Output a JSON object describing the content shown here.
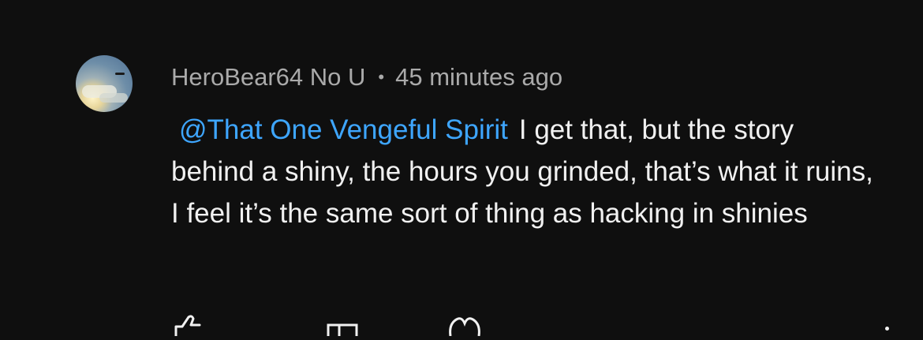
{
  "comment": {
    "author": "HeroBear64 No U",
    "separator": "•",
    "timestamp": "45 minutes ago",
    "mention": "@That One Vengeful Spirit",
    "text": "I get that, but the story behind a shiny, the hours you grinded, that’s what it ruins, I feel it’s the same sort of thing as hacking in shinies"
  },
  "icons": {
    "avatar": "avatar-image",
    "like": "thumbs-up-icon",
    "dislike": "thumbs-down-icon",
    "heart": "heart-icon",
    "more": "more-vertical-icon"
  },
  "colors": {
    "background": "#0f0f0f",
    "mention": "#3ea6ff",
    "meta_text": "#aaaaaa",
    "body_text": "#f1f1f1"
  }
}
